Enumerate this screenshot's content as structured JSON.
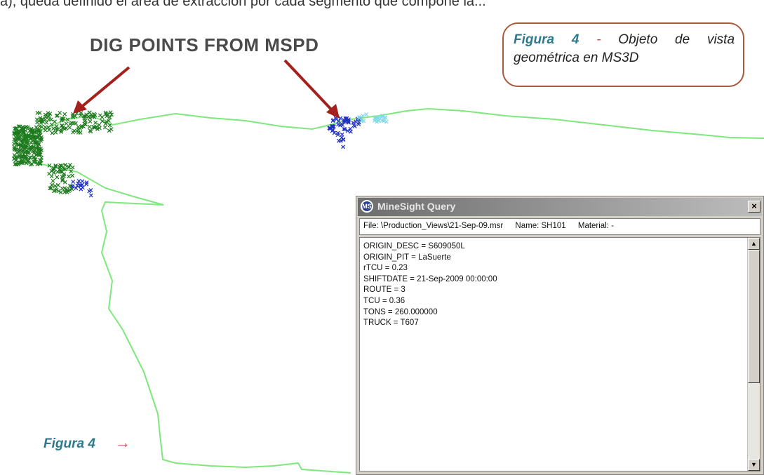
{
  "doc": {
    "top_text": "a), queda definido el área de extracción por cada segmento que compone la...",
    "dig_label": "DIG POINTS FROM MSPD",
    "caption": {
      "figure": "Figura 4",
      "separator": "-",
      "text": "Objeto de vista geométrica en MS3D"
    },
    "figure_ref": "Figura 4",
    "figure_ref_arrow": "→"
  },
  "query_window": {
    "title": "MineSight Query",
    "logo": "MS",
    "close_icon": "×",
    "file": "File: \\Production_Views\\21-Sep-09.msr",
    "name": "Name: SH101",
    "material": "Material: -",
    "lines": [
      "ORIGIN_DESC = S609050L",
      "ORIGIN_PIT = LaSuerte",
      "rTCU = 0.23",
      "SHIFTDATE = 21-Sep-2009 00:00:00",
      "ROUTE = 3",
      "TCU = 0.36",
      "TONS = 260.000000",
      "TRUCK = T607"
    ],
    "scroll_up_icon": "▲",
    "scroll_down_icon": "▼"
  },
  "colors": {
    "outline": "#7ee87e",
    "dig_green": "#1e7a1e",
    "dig_blue": "#1f2fc4",
    "dig_cyan": "#7fd9e8",
    "arrow_red": "#a3201c",
    "caption_border": "#a65a3e",
    "caption_blue": "#2e7a8c"
  },
  "icons": {
    "dig_arrows": "arrow-icon",
    "window_logo": "minesight-logo-icon",
    "close": "close-icon"
  }
}
